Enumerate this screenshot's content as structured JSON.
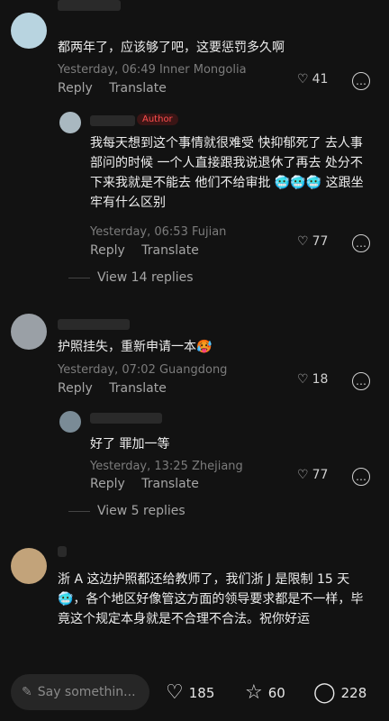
{
  "comments": [
    {
      "text": "都两年了，应该够了吧，这要惩罚多久啊",
      "meta": "Yesterday, 06:49 Inner Mongolia",
      "reply": "Reply",
      "translate": "Translate",
      "likes": "41"
    },
    {
      "badge": "Author",
      "text": "我每天想到这个事情就很难受 快抑郁死了 去人事部问的时候 一个人直接跟我说退休了再去 处分不下来我就是不能去 他们不给审批 🥶🥶🥶 这跟坐牢有什么区别",
      "meta": "Yesterday, 06:53 Fujian",
      "reply": "Reply",
      "translate": "Translate",
      "likes": "77",
      "view_replies": "View 14 replies"
    },
    {
      "text": "护照挂失，重新申请一本🥵",
      "meta": "Yesterday, 07:02 Guangdong",
      "reply": "Reply",
      "translate": "Translate",
      "likes": "18"
    },
    {
      "text": "好了 罪加一等",
      "meta": "Yesterday, 13:25 Zhejiang",
      "reply": "Reply",
      "translate": "Translate",
      "likes": "77",
      "view_replies": "View 5 replies"
    },
    {
      "text": "浙 A 这边护照都还给教师了，我们浙 J 是限制 15 天🥶，各个地区好像管这方面的领导要求都是不一样，毕竟这个规定本身就是不合理不合法。祝你好运"
    }
  ],
  "bottom": {
    "placeholder": "Say somethin...",
    "likes": "185",
    "stars": "60",
    "comments": "228"
  }
}
